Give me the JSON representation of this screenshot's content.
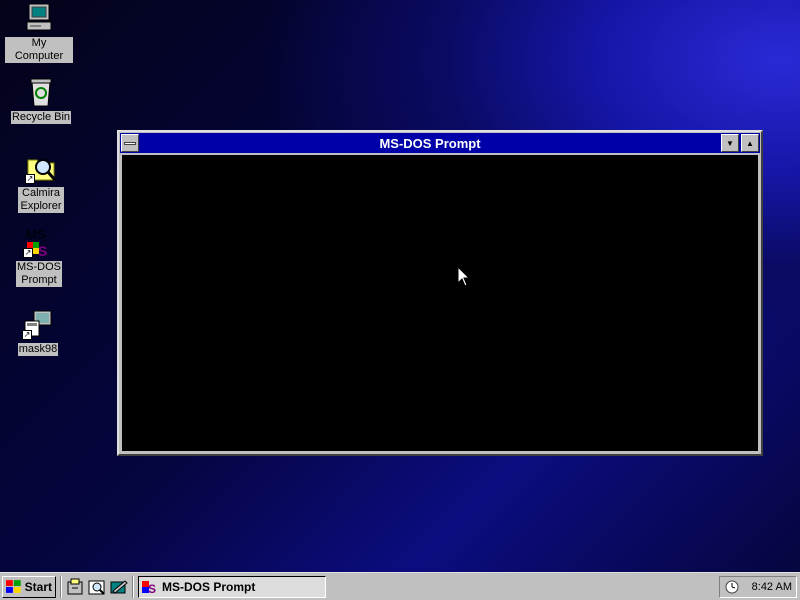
{
  "desktop": {
    "icons": [
      {
        "label": "My Computer",
        "icon": "my-computer-icon"
      },
      {
        "label": "Recycle Bin",
        "icon": "recycle-bin-icon"
      },
      {
        "label": "Calmira Explorer",
        "icon": "calmira-explorer-icon"
      },
      {
        "label": "MS-DOS Prompt",
        "icon": "ms-dos-icon"
      },
      {
        "label": "mask98",
        "icon": "mask98-icon"
      }
    ],
    "colors": {
      "background_top": "#1616a8",
      "background_dark": "#050540"
    }
  },
  "window": {
    "title": "MS-DOS Prompt",
    "titlebar_color": "#0000a8",
    "console_color": "#000000"
  },
  "taskbar": {
    "start_label": "Start",
    "quick_launch": [
      "file-cabinet-icon",
      "explorer-icon",
      "show-desktop-icon"
    ],
    "active_task": "MS-DOS Prompt",
    "clock": "8:42 AM",
    "tray_icon": "scheduler-icon"
  }
}
